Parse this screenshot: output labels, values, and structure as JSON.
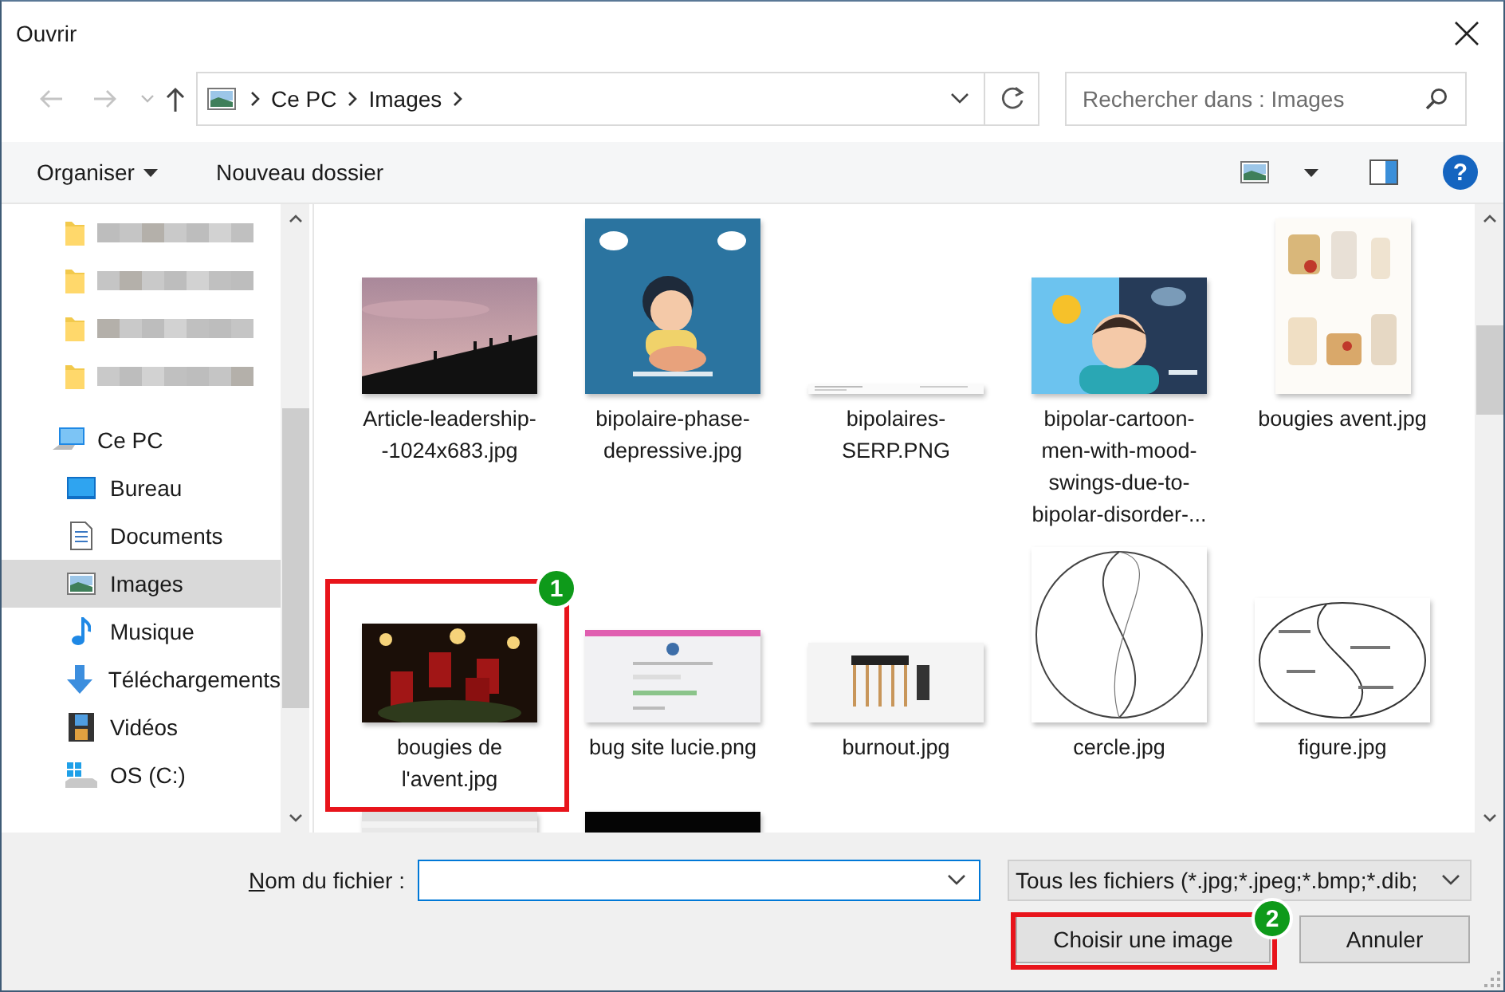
{
  "window": {
    "title": "Ouvrir"
  },
  "navigation": {
    "back_disabled": true,
    "forward_disabled": true,
    "breadcrumbs": [
      "Ce PC",
      "Images"
    ],
    "search": {
      "placeholder": "Rechercher dans : Images"
    }
  },
  "toolbar": {
    "organize": "Organiser",
    "new_folder": "Nouveau dossier",
    "help": "?"
  },
  "sidebar": {
    "items": [
      {
        "kind": "blurred"
      },
      {
        "kind": "blurred"
      },
      {
        "kind": "blurred"
      },
      {
        "kind": "blurred"
      },
      {
        "kind": "location",
        "label": "Ce PC",
        "selected": false,
        "children": [
          {
            "label": "Bureau",
            "selected": false
          },
          {
            "label": "Documents",
            "selected": false
          },
          {
            "label": "Images",
            "selected": true
          },
          {
            "label": "Musique",
            "selected": false
          },
          {
            "label": "Téléchargements",
            "selected": false
          },
          {
            "label": "Vidéos",
            "selected": false
          },
          {
            "label": "OS (C:)",
            "selected": false
          }
        ]
      }
    ]
  },
  "files": [
    {
      "kind": "file",
      "name": "Article-leadership--1024x683.jpg"
    },
    {
      "kind": "file",
      "name": "bipolaire-phase-depressive.jpg"
    },
    {
      "kind": "file",
      "name": "bipolaires-SERP.PNG"
    },
    {
      "kind": "file",
      "name": "bipolar-cartoon-men-with-mood-swings-due-to-bipolar-disorder-..."
    },
    {
      "kind": "file",
      "name": "bougies avent.jpg"
    },
    {
      "kind": "file",
      "name": "bougies de l'avent.jpg",
      "annotation": "1"
    },
    {
      "kind": "file",
      "name": "bug site lucie.png"
    },
    {
      "kind": "file",
      "name": "burnout.jpg"
    },
    {
      "kind": "file",
      "name": "cercle.jpg"
    },
    {
      "kind": "file",
      "name": "figure.jpg"
    },
    {
      "kind": "picture"
    },
    {
      "kind": "picture"
    }
  ],
  "bottom": {
    "filename_label": "Nom du fichier :",
    "filetype": "Tous les fichiers (*.jpg;*.jpeg;*.bmp;*.dib;",
    "buttons": [
      {
        "label": "Choisir une image",
        "annotation": "2"
      },
      {
        "label": "Annuler"
      }
    ]
  }
}
